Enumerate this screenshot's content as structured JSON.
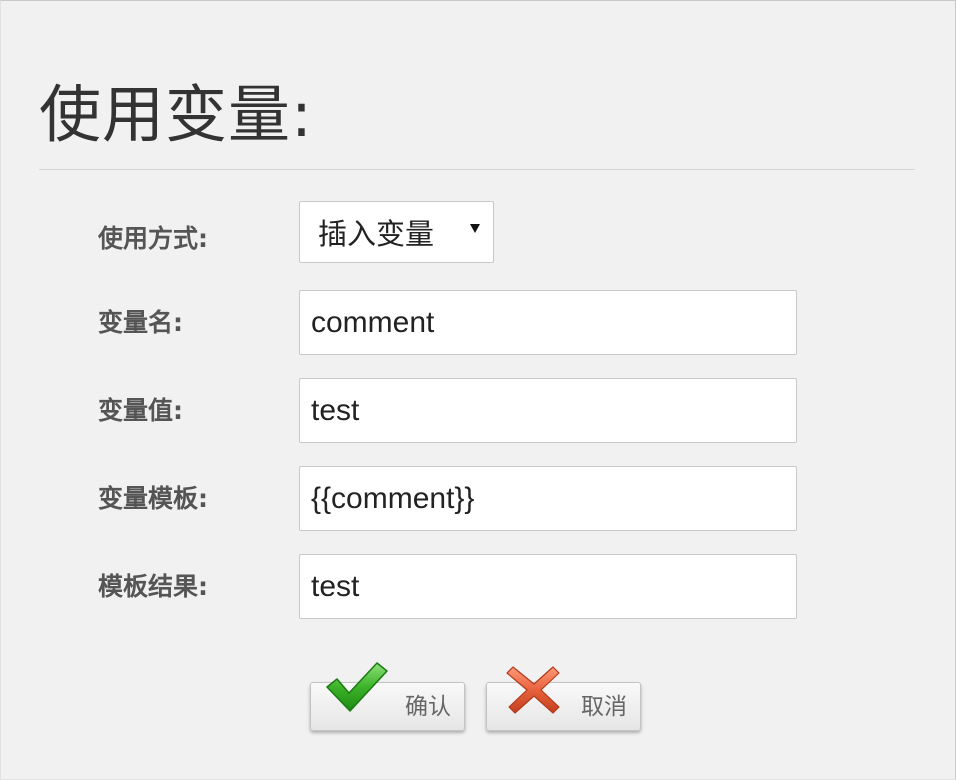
{
  "header": {
    "title": "使用变量:"
  },
  "form": {
    "mode": {
      "label": "使用方式:",
      "selected": "插入变量"
    },
    "var_name": {
      "label": "变量名:",
      "value": "comment"
    },
    "var_value": {
      "label": "变量值:",
      "value": "test"
    },
    "var_template": {
      "label": "变量模板:",
      "value": "{{comment}}"
    },
    "template_result": {
      "label": "模板结果:",
      "value": "test"
    }
  },
  "actions": {
    "confirm": {
      "label": "确认",
      "icon": "check-icon",
      "icon_color": "#3cb329"
    },
    "cancel": {
      "label": "取消",
      "icon": "close-icon",
      "icon_color": "#e8613c"
    }
  },
  "colors": {
    "background": "#f1f1f1",
    "field_border": "#c9c9c9",
    "label_text": "#555555",
    "title_text": "#333333"
  }
}
